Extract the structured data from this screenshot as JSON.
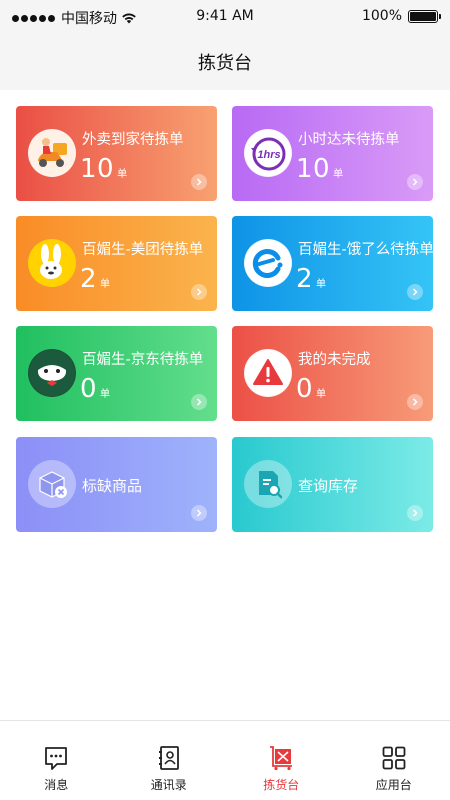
{
  "status_bar": {
    "carrier": "中国移动",
    "time": "9:41 AM",
    "battery": "100%"
  },
  "nav": {
    "title": "拣货台"
  },
  "cards": [
    {
      "id": "takeout-pending",
      "title": "外卖到家待拣单",
      "count": "10",
      "unit": "单",
      "icon": "delivery-scooter-icon",
      "colors": [
        "#ea4f45",
        "#f8a171"
      ]
    },
    {
      "id": "hourly-pending",
      "title": "小时达未待拣单",
      "count": "10",
      "unit": "单",
      "icon": "1hrs-clock-icon",
      "colors": [
        "#b86af4",
        "#d99bf7"
      ]
    },
    {
      "id": "meituan-pending",
      "title": "百媚生-美团待拣单",
      "count": "2",
      "unit": "单",
      "icon": "meituan-kangaroo-icon",
      "colors": [
        "#f98c26",
        "#fbb44d"
      ]
    },
    {
      "id": "eleme-pending",
      "title": "百媚生-饿了么待拣单",
      "count": "2",
      "unit": "单",
      "icon": "eleme-logo-icon",
      "colors": [
        "#0e93e6",
        "#35c4f6"
      ]
    },
    {
      "id": "jd-pending",
      "title": "百媚生-京东待拣单",
      "count": "0",
      "unit": "单",
      "icon": "jd-dog-icon",
      "colors": [
        "#20bf60",
        "#63de8c"
      ]
    },
    {
      "id": "unfinished",
      "title": "我的未完成",
      "count": "0",
      "unit": "单",
      "icon": "warning-icon",
      "colors": [
        "#ec5046",
        "#f79b78"
      ]
    },
    {
      "id": "missing-goods",
      "title": "标缺商品",
      "icon": "box-remove-icon",
      "colors": [
        "#8c8ff7",
        "#9eb3fb"
      ]
    },
    {
      "id": "inventory-query",
      "title": "查询库存",
      "icon": "doc-search-icon",
      "colors": [
        "#28c9cf",
        "#7cebe7"
      ]
    }
  ],
  "tabs": [
    {
      "label": "消息",
      "icon": "chat-bubble-icon",
      "active": false
    },
    {
      "label": "通讯录",
      "icon": "contacts-icon",
      "active": false
    },
    {
      "label": "拣货台",
      "icon": "picking-cart-icon",
      "active": true
    },
    {
      "label": "应用台",
      "icon": "apps-grid-icon",
      "active": false
    }
  ],
  "theme": {
    "active_tab": "#e8393c",
    "status_bg": "#f5f5f5"
  }
}
